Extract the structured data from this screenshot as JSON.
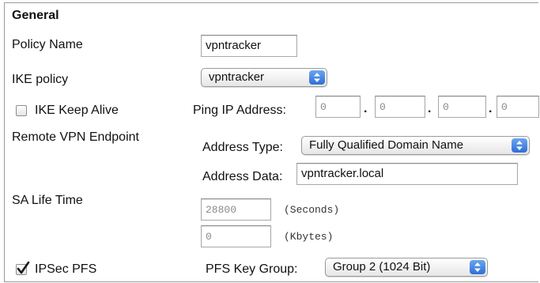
{
  "section": {
    "title": "General"
  },
  "policy_name": {
    "label": "Policy Name",
    "value": "vpntracker"
  },
  "ike_policy": {
    "label": "IKE policy",
    "selected": "vpntracker"
  },
  "ike_keep_alive": {
    "label": "IKE Keep Alive",
    "checked": false,
    "ping_label": "Ping IP Address:",
    "ip": [
      "0",
      "0",
      "0",
      "0"
    ],
    "separator": "."
  },
  "remote_endpoint": {
    "label": "Remote VPN Endpoint",
    "address_type_label": "Address Type:",
    "address_type_selected": "Fully Qualified Domain Name",
    "address_data_label": "Address Data:",
    "address_data_value": "vpntracker.local"
  },
  "sa_life_time": {
    "label": "SA Life Time",
    "seconds_value": "28800",
    "seconds_unit": "(Seconds)",
    "kbytes_value": "0",
    "kbytes_unit": "(Kbytes)"
  },
  "ipsec_pfs": {
    "label": "IPSec PFS",
    "checked": true,
    "key_group_label": "PFS Key Group:",
    "key_group_selected": "Group 2 (1024 Bit)"
  },
  "colors": {
    "accent": "#3f7fe0",
    "border": "#9a9a9a",
    "dim_text": "#8a8a8a"
  }
}
